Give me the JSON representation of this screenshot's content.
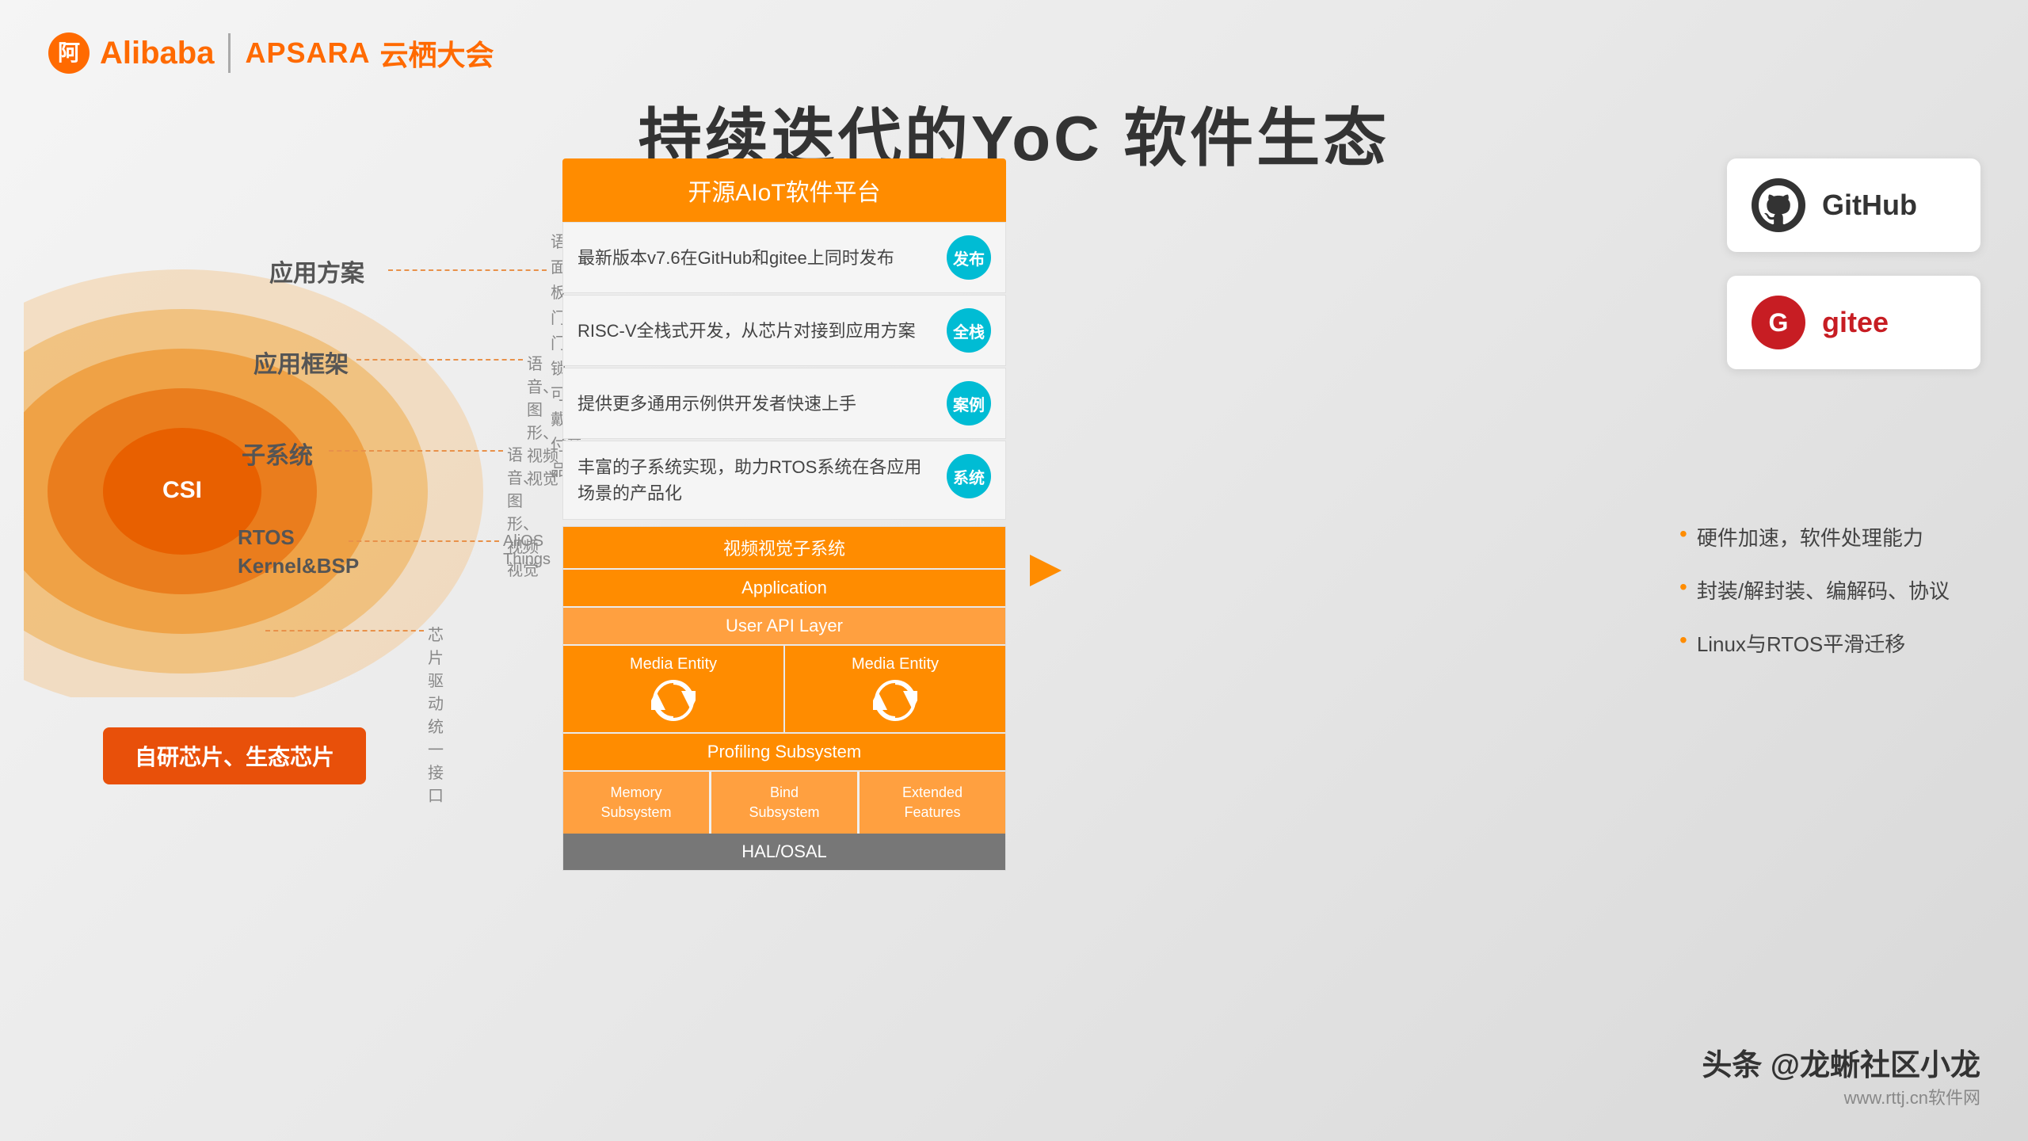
{
  "header": {
    "alibaba_label": "Alibaba",
    "apsara_label": "APSARA",
    "yunqi_label": "云栖大会"
  },
  "title": {
    "main": "持续迭代的YoC 软件生态"
  },
  "left_diagram": {
    "layers": [
      {
        "label": "应用方案",
        "desc": "语音面板、\n门铃门锁、\n可穿戴支付产品"
      },
      {
        "label": "应用框架",
        "desc": "语音、图形、视频视觉"
      },
      {
        "label": "子系统",
        "desc": "语音、图形、视频视觉"
      },
      {
        "label": "RTOS\nKernel&BSP",
        "desc": "AliOS Things"
      },
      {
        "label": "CSI",
        "desc": "芯片驱动统一接口"
      }
    ],
    "bottom_btn": "自研芯片、生态芯片"
  },
  "platform": {
    "header": "开源AIoT软件平台",
    "rows": [
      {
        "text": "最新版本v7.6在GitHub和gitee上同时发布",
        "badge": "发布"
      },
      {
        "text": "RISC-V全栈式开发，从芯片对接到应用方案",
        "badge": "全栈"
      },
      {
        "text": "提供更多通用示例供开发者快速上手",
        "badge": "案例"
      },
      {
        "text": "丰富的子系统实现，助力RTOS系统在各应用场景的产品化",
        "badge": "系统"
      }
    ]
  },
  "arch": {
    "rows": [
      {
        "label": "视频视觉子系统",
        "type": "orange"
      },
      {
        "label": "Application",
        "type": "orange"
      },
      {
        "label": "User API Layer",
        "type": "light-orange"
      },
      {
        "label": "media_entities",
        "type": "media"
      },
      {
        "label": "Profiling Subsystem",
        "type": "orange"
      },
      {
        "label": "subsystems",
        "type": "subsystem"
      },
      {
        "label": "HAL/OSAL",
        "type": "gray"
      }
    ],
    "media_entity_left": "Media Entity",
    "media_entity_right": "Media Entity",
    "subsystems": [
      {
        "label": "Memory\nSubsystem"
      },
      {
        "label": "Bind\nSubsystem"
      },
      {
        "label": "Extended\nFeatures"
      }
    ]
  },
  "right": {
    "github_label": "GitHub",
    "gitee_label": "gitee"
  },
  "features": [
    {
      "text": "硬件加速，软件处理能力"
    },
    {
      "text": "封装/解封装、编解码、协议"
    },
    {
      "text": "Linux与RTOS平滑迁移"
    }
  ],
  "watermark": {
    "main": "头条 @龙蜥社区小龙",
    "sub": "www.rttj.cn软件网"
  }
}
